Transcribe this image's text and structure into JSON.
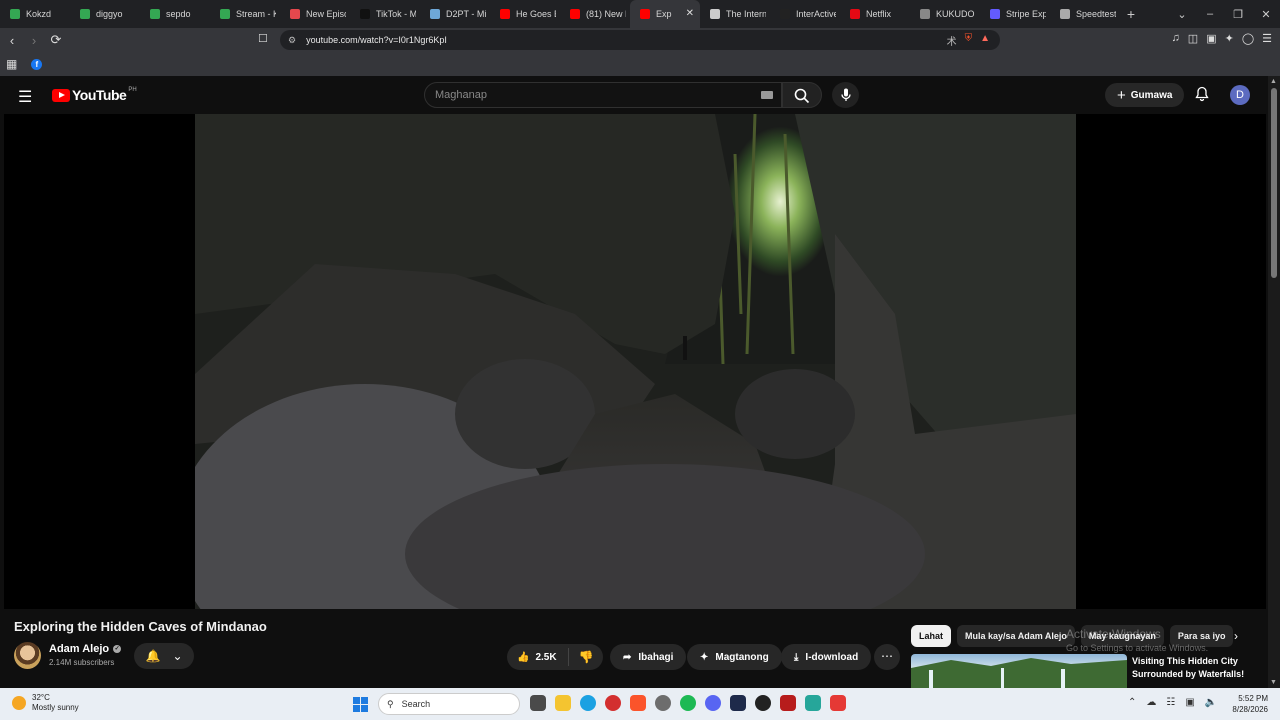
{
  "browser": {
    "tabs": [
      {
        "title": "Kokzd",
        "color": "#34a853"
      },
      {
        "title": "diggyo",
        "color": "#34a853"
      },
      {
        "title": "sepdo",
        "color": "#34a853"
      },
      {
        "title": "Stream - K",
        "color": "#34a853"
      },
      {
        "title": "New Episo",
        "color": "#e5484d"
      },
      {
        "title": "TikTok - M",
        "color": "#111111"
      },
      {
        "title": "D2PT - Mi",
        "color": "#6ea8d8"
      },
      {
        "title": "He Goes B",
        "color": "#ff0000"
      },
      {
        "title": "(81) New F",
        "color": "#ff0000"
      },
      {
        "title": "Exp",
        "color": "#ff0000",
        "active": true
      },
      {
        "title": "The Intern",
        "color": "#cccccc"
      },
      {
        "title": "InterActive",
        "color": "#222222"
      },
      {
        "title": "Netflix",
        "color": "#e50914"
      },
      {
        "title": "KUKUDO",
        "color": "#888888"
      },
      {
        "title": "Stripe Exp",
        "color": "#635bff"
      },
      {
        "title": "Speedtest",
        "color": "#aaaaaa"
      }
    ],
    "new_tab": "+",
    "url": "youtube.com/watch?v=I0r1Ngr6KpI"
  },
  "youtube": {
    "logo_text": "YouTube",
    "country_code": "PH",
    "search_placeholder": "Maghanap",
    "create_label": "Gumawa",
    "avatar_letter": "D"
  },
  "video": {
    "title": "Exploring the Hidden Caves of Mindanao",
    "channel": "Adam Alejo",
    "subscribers": "2.14M subscribers",
    "likes": "2.5K",
    "share_label": "Ibahagi",
    "ask_label": "Magtanong",
    "download_label": "I-download"
  },
  "chips": [
    "Lahat",
    "Mula kay/sa Adam Alejo",
    "May kaugnayan",
    "Para sa iyo"
  ],
  "recommended": {
    "title": "Visiting This Hidden City Surrounded by Waterfalls!"
  },
  "watermark": {
    "line1": "Activate Windows",
    "line2": "Go to Settings to activate Windows."
  },
  "taskbar": {
    "temperature": "32°C",
    "weather": "Mostly sunny",
    "search_label": "Search",
    "time": "5:52 PM",
    "date": "8/28/2026"
  }
}
